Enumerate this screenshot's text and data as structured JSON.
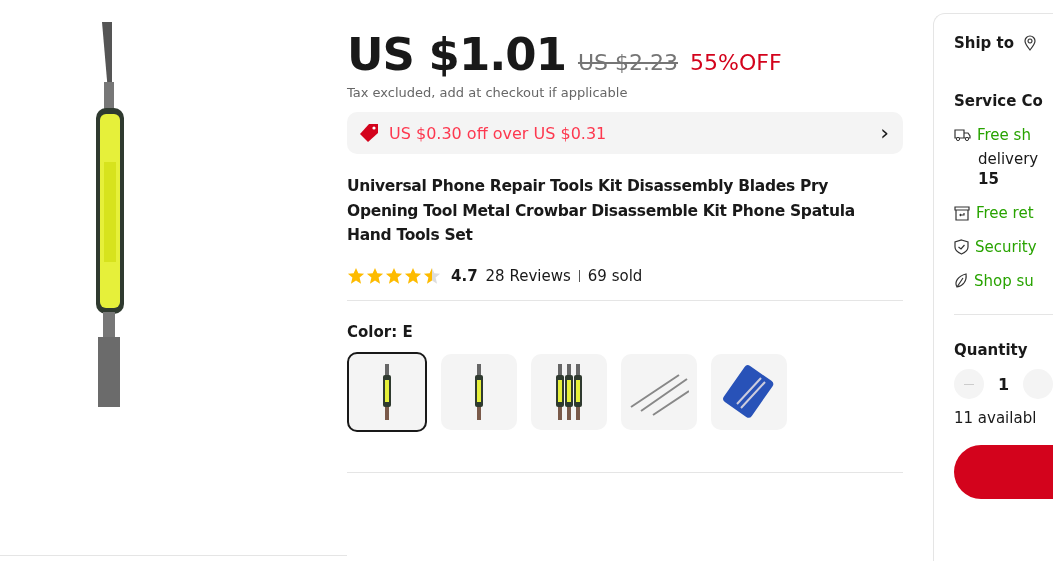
{
  "price": {
    "current": "US $1.01",
    "original": "US $2.23",
    "discount": "55%OFF",
    "tax_note": "Tax excluded, add at checkout if applicable"
  },
  "coupon": {
    "text": "US $0.30 off over US $0.31",
    "arrow": "›"
  },
  "title": "Universal Phone Repair Tools Kit Disassembly Blades Pry Opening Tool Metal Crowbar Disassemble Kit Phone Spatula Hand Tools Set",
  "rating": {
    "stars": 4.5,
    "score": "4.7",
    "reviews": "28 Reviews",
    "sold": "69 sold"
  },
  "color": {
    "label": "Color: E",
    "variants": [
      {
        "selected": true
      },
      {
        "selected": false
      },
      {
        "selected": false
      },
      {
        "selected": false
      },
      {
        "selected": false
      }
    ]
  },
  "side_panel": {
    "ship_to": "Ship to",
    "service_heading": "Service Co",
    "services": [
      {
        "kind": "shipping",
        "text": "Free sh",
        "detail": "delivery",
        "detail_bold": "15"
      },
      {
        "kind": "returns",
        "text": "Free ret"
      },
      {
        "kind": "security",
        "text": "Security"
      },
      {
        "kind": "sustainable",
        "text": "Shop su"
      }
    ],
    "quantity_label": "Quantity",
    "quantity": "1",
    "available": "11 availabl"
  }
}
